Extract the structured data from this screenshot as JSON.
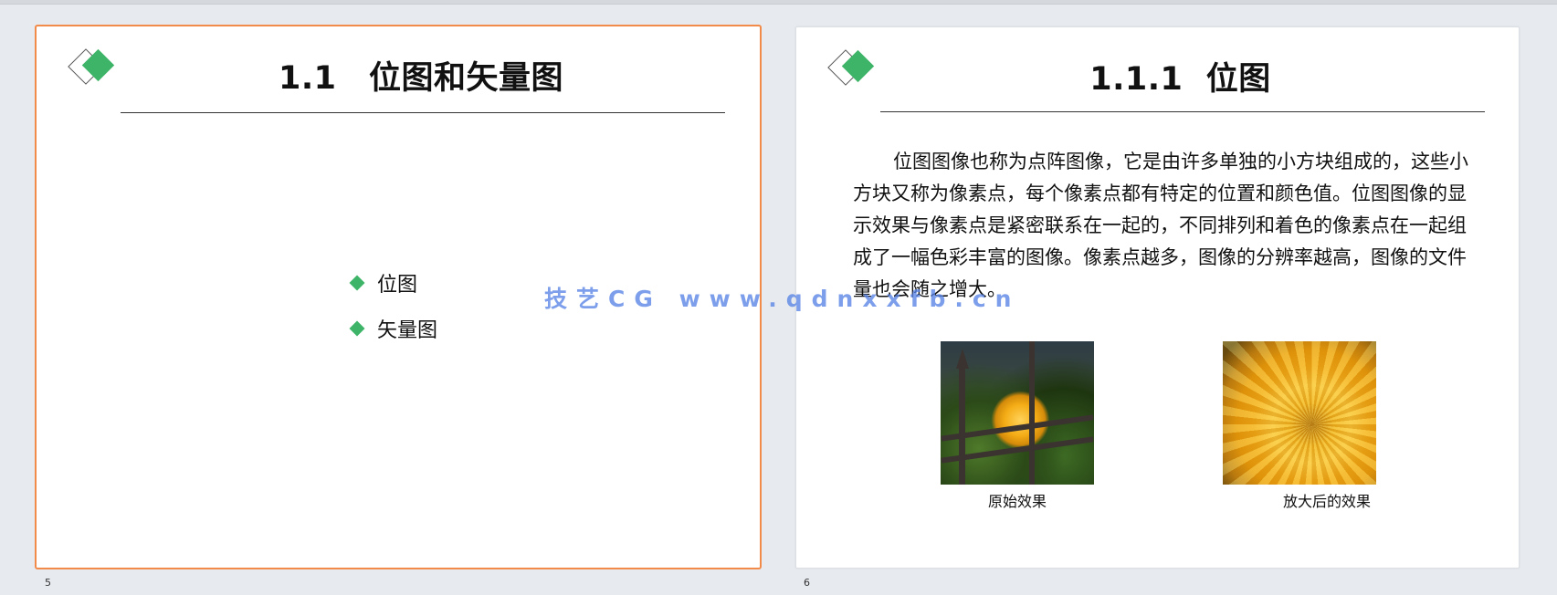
{
  "slides": [
    {
      "number": "5",
      "title": "1.1　位图和矢量图",
      "bullets": [
        "位图",
        "矢量图"
      ]
    },
    {
      "number": "6",
      "title": "1.1.1  位图",
      "paragraph": "位图图像也称为点阵图像，它是由许多单独的小方块组成的，这些小方块又称为像素点，每个像素点都有特定的位置和颜色值。位图图像的显示效果与像素点是紧密联系在一起的，不同排列和着色的像素点在一起组成了一幅色彩丰富的图像。像素点越多，图像的分辨率越高，图像的文件量也会随之增大。",
      "images": [
        {
          "caption": "原始效果"
        },
        {
          "caption": "放大后的效果"
        }
      ]
    }
  ],
  "watermark": "技艺CG www.qdnxxfb.cn",
  "colors": {
    "accent_green": "#3db467",
    "selected_border": "#f28a4a",
    "watermark": "#5884e6"
  }
}
